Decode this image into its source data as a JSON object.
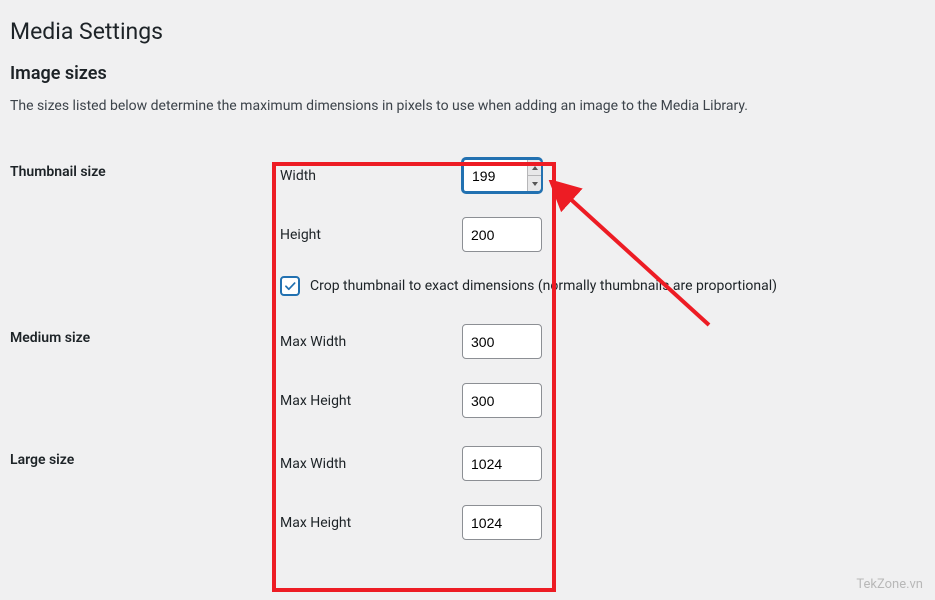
{
  "page": {
    "title": "Media Settings",
    "section_title": "Image sizes",
    "description": "The sizes listed below determine the maximum dimensions in pixels to use when adding an image to the Media Library."
  },
  "thumbnail": {
    "heading": "Thumbnail size",
    "width_label": "Width",
    "width_value": "199",
    "height_label": "Height",
    "height_value": "200",
    "crop_checked": true,
    "crop_label": "Crop thumbnail to exact dimensions (normally thumbnails are proportional)"
  },
  "medium": {
    "heading": "Medium size",
    "maxwidth_label": "Max Width",
    "maxwidth_value": "300",
    "maxheight_label": "Max Height",
    "maxheight_value": "300"
  },
  "large": {
    "heading": "Large size",
    "maxwidth_label": "Max Width",
    "maxwidth_value": "1024",
    "maxheight_label": "Max Height",
    "maxheight_value": "1024"
  },
  "watermark": "TekZone.vn"
}
